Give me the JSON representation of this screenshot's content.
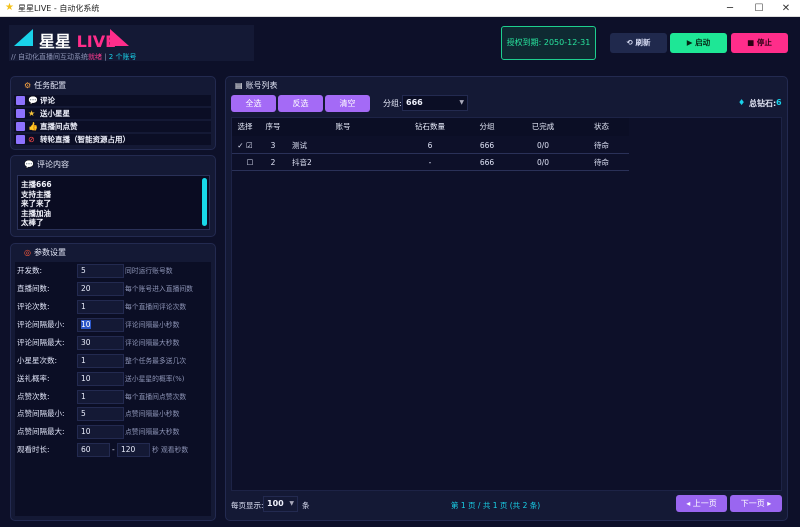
{
  "window": {
    "title": "星星LIVE - 自动化系统",
    "app_icon": "star-icon",
    "minimize": "─",
    "maximize": "☐",
    "close": "✕"
  },
  "header": {
    "logo_part1": "星星",
    "logo_part2": "LIVE",
    "subtitle": "// 自动化直播间互动系统",
    "subtitle_status": "就绪",
    "subtitle_sep": " | ",
    "subtitle_accounts": "2 个账号",
    "license": "授权到期: 2050-12-31",
    "refresh_label": "⟲ 刷新",
    "start_label": "▶ 启动",
    "stop_label": "■ 停止"
  },
  "task_config": {
    "title": "任务配置",
    "items": [
      {
        "label": "评论",
        "icon": "💬",
        "checked": true
      },
      {
        "label": "送小星星",
        "icon": "★",
        "checked": true
      },
      {
        "label": "直播间点赞",
        "icon": "👍",
        "checked": true
      },
      {
        "label": "转轮直播（智能资源占用）",
        "icon": "⊘",
        "checked": true
      }
    ]
  },
  "comments": {
    "title": "评论内容",
    "lines": [
      "主播666",
      "支持主播",
      "来了来了",
      "主播加油",
      "太棒了"
    ]
  },
  "params": {
    "title": "参数设置",
    "rows": [
      {
        "label": "开发数:",
        "value": "5",
        "desc": "同时运行账号数"
      },
      {
        "label": "直播间数:",
        "value": "20",
        "desc": "每个账号进入直播间数"
      },
      {
        "label": "评论次数:",
        "value": "1",
        "desc": "每个直播间评论次数"
      },
      {
        "label": "评论间隔最小:",
        "value": "10",
        "desc": "评论间隔最小秒数"
      },
      {
        "label": "评论间隔最大:",
        "value": "30",
        "desc": "评论间隔最大秒数"
      },
      {
        "label": "小星星次数:",
        "value": "1",
        "desc": "整个任务最多送几次"
      },
      {
        "label": "送礼概率:",
        "value": "10",
        "desc": "送小星星的概率(%)"
      },
      {
        "label": "点赞次数:",
        "value": "1",
        "desc": "每个直播间点赞次数"
      },
      {
        "label": "点赞间隔最小:",
        "value": "5",
        "desc": "点赞间隔最小秒数"
      },
      {
        "label": "点赞间隔最大:",
        "value": "10",
        "desc": "点赞间隔最大秒数"
      }
    ],
    "watch": {
      "label": "观看时长:",
      "min": "60",
      "sep": "-",
      "max": "120",
      "desc": "秒 观看秒数"
    }
  },
  "accounts": {
    "title": "账号列表",
    "select_all": "全选",
    "invert": "反选",
    "clear": "清空",
    "group_label": "分组:",
    "group_value": "666",
    "diamond_label": "总钻石:",
    "diamond_value": "6",
    "columns": [
      "选择",
      "序号",
      "账号",
      "钻石数量",
      "分组",
      "已完成",
      "状态"
    ],
    "rows": [
      {
        "select": "✓ ☑",
        "index": "3",
        "account": "测试",
        "diamonds": "6",
        "group": "666",
        "done": "0/0",
        "status": "待命"
      },
      {
        "select": "☐",
        "index": "2",
        "account": "抖音2",
        "diamonds": "-",
        "group": "666",
        "done": "0/0",
        "status": "待命"
      }
    ],
    "per_page_label": "每页显示:",
    "per_page_value": "100",
    "per_page_unit": "条",
    "page_info": "第 1 页 / 共 1 页 (共 2 条)",
    "prev": "◂ 上一页",
    "next": "下一页 ▸"
  },
  "colors": {
    "accent_cyan": "#19d2ea",
    "accent_pink": "#ff2d8a",
    "accent_green": "#1ee796",
    "accent_purple": "#a46af6",
    "bg": "#0d1029"
  }
}
